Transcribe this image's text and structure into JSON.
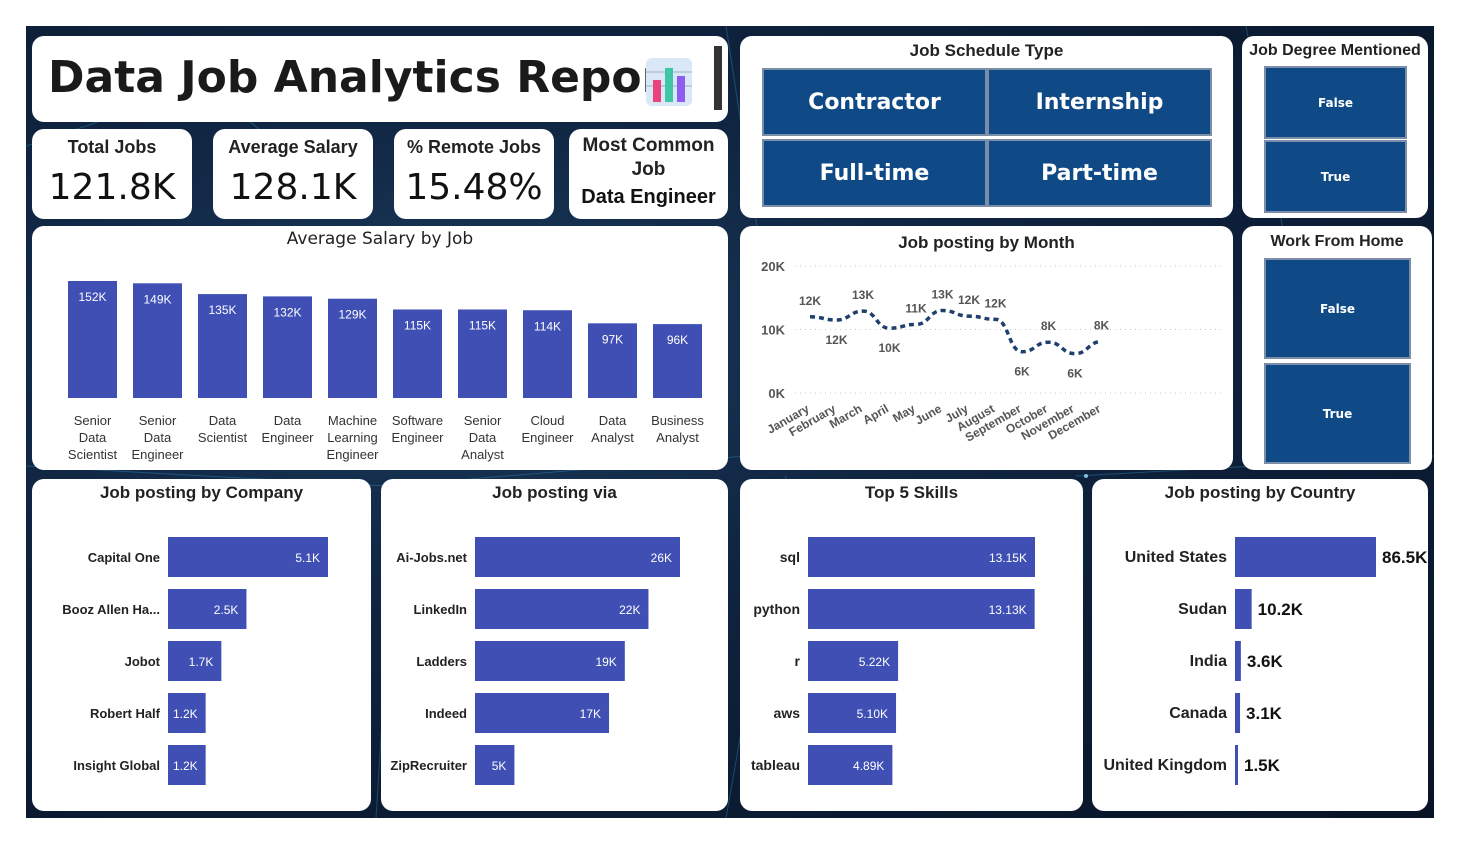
{
  "header": {
    "title": "Data Job Analytics Report",
    "icon": "bar-chart-icon"
  },
  "kpis": [
    {
      "label": "Total Jobs",
      "value": "121.8K"
    },
    {
      "label": "Average Salary",
      "value": "128.1K"
    },
    {
      "label": "% Remote Jobs",
      "value": "15.48%"
    }
  ],
  "most_common": {
    "label_line1": "Most Common",
    "label_line2": "Job",
    "value": "Data Engineer"
  },
  "schedule": {
    "title": "Job Schedule Type",
    "options": [
      "Contractor",
      "Internship",
      "Full-time",
      "Part-time"
    ]
  },
  "degree": {
    "title": "Job Degree Mentioned",
    "options": [
      "False",
      "True"
    ]
  },
  "wfh": {
    "title": "Work From Home",
    "options": [
      "False",
      "True"
    ]
  },
  "colors": {
    "bar": "#3f4fb3",
    "slicer": "#0f4a86",
    "line": "#1f3f6e",
    "background": "#0f2440"
  },
  "chart_data": [
    {
      "id": "salary",
      "type": "bar",
      "title": "Average Salary by Job",
      "categories": [
        "Senior Data Scientist",
        "Senior Data Engineer",
        "Data Scientist",
        "Data Engineer",
        "Machine Learning Engineer",
        "Software Engineer",
        "Senior Data Analyst",
        "Cloud Engineer",
        "Data Analyst",
        "Business Analyst"
      ],
      "category_lines": [
        [
          "Senior",
          "Data",
          "Scientist"
        ],
        [
          "Senior",
          "Data",
          "Engineer"
        ],
        [
          "Data",
          "Scientist"
        ],
        [
          "Data",
          "Engineer"
        ],
        [
          "Machine",
          "Learning",
          "Engineer"
        ],
        [
          "Software",
          "Engineer"
        ],
        [
          "Senior",
          "Data",
          "Analyst"
        ],
        [
          "Cloud",
          "Engineer"
        ],
        [
          "Data",
          "Analyst"
        ],
        [
          "Business",
          "Analyst"
        ]
      ],
      "values": [
        152,
        149,
        135,
        132,
        129,
        115,
        115,
        114,
        97,
        96
      ],
      "labels": [
        "152K",
        "149K",
        "135K",
        "132K",
        "129K",
        "115K",
        "115K",
        "114K",
        "97K",
        "96K"
      ]
    },
    {
      "id": "month",
      "type": "line",
      "title": "Job posting by Month",
      "x": [
        "January",
        "February",
        "March",
        "April",
        "May",
        "June",
        "July",
        "August",
        "September",
        "October",
        "November",
        "December"
      ],
      "values": [
        12,
        11.5,
        12.9,
        10.2,
        10.8,
        13,
        12.1,
        11.6,
        6.5,
        8,
        6.2,
        8.1
      ],
      "labels": [
        "12K",
        "12K",
        "13K",
        "10K",
        "11K",
        "13K",
        "12K",
        "12K",
        "6K",
        "8K",
        "6K",
        "8K"
      ],
      "yticks": [
        "0K",
        "10K",
        "20K"
      ],
      "ylim": [
        0,
        20
      ]
    },
    {
      "id": "company",
      "type": "bar",
      "title": "Job posting by Company",
      "categories": [
        "Capital One",
        "Booz Allen Ha...",
        "Jobot",
        "Robert Half",
        "Insight Global"
      ],
      "values": [
        5.1,
        2.5,
        1.7,
        1.2,
        1.2
      ],
      "labels": [
        "5.1K",
        "2.5K",
        "1.7K",
        "1.2K",
        "1.2K"
      ]
    },
    {
      "id": "via",
      "type": "bar",
      "title": "Job posting via",
      "categories": [
        "Ai-Jobs.net",
        "LinkedIn",
        "Ladders",
        "Indeed",
        "ZipRecruiter"
      ],
      "values": [
        26,
        22,
        19,
        17,
        5
      ],
      "labels": [
        "26K",
        "22K",
        "19K",
        "17K",
        "5K"
      ]
    },
    {
      "id": "skills",
      "type": "bar",
      "title": "Top 5 Skills",
      "categories": [
        "sql",
        "python",
        "r",
        "aws",
        "tableau"
      ],
      "values": [
        13.15,
        13.13,
        5.22,
        5.1,
        4.89
      ],
      "labels": [
        "13.15K",
        "13.13K",
        "5.22K",
        "5.10K",
        "4.89K"
      ]
    },
    {
      "id": "country",
      "type": "bar",
      "title": "Job posting by Country",
      "categories": [
        "United States",
        "Sudan",
        "India",
        "Canada",
        "United Kingdom"
      ],
      "values": [
        86.5,
        10.2,
        3.6,
        3.1,
        1.5
      ],
      "labels": [
        "86.5K",
        "10.2K",
        "3.6K",
        "3.1K",
        "1.5K"
      ]
    }
  ]
}
